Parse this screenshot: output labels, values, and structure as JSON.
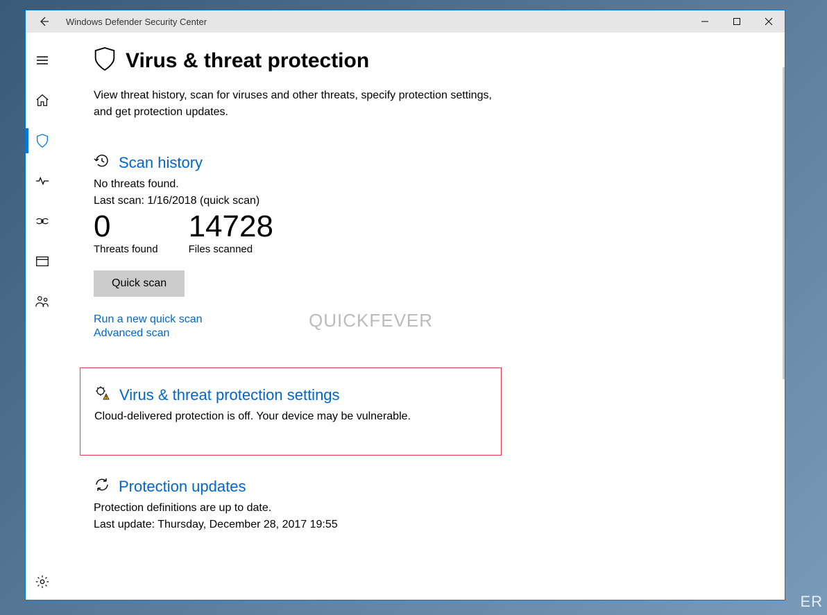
{
  "window": {
    "title": "Windows Defender Security Center"
  },
  "page": {
    "title": "Virus & threat protection",
    "description": "View threat history, scan for viruses and other threats, specify protection settings, and get protection updates."
  },
  "scan_history": {
    "heading": "Scan history",
    "no_threats": "No threats found.",
    "last_scan": "Last scan: 1/16/2018 (quick scan)",
    "threats_found_value": "0",
    "threats_found_label": "Threats found",
    "files_scanned_value": "14728",
    "files_scanned_label": "Files scanned",
    "quick_scan_btn": "Quick scan",
    "run_new_link": "Run a new quick scan",
    "advanced_link": "Advanced scan"
  },
  "settings_section": {
    "heading": "Virus & threat protection settings",
    "warning": "Cloud-delivered protection is off. Your device may be vulnerable."
  },
  "updates_section": {
    "heading": "Protection updates",
    "status": "Protection definitions are up to date.",
    "last_update": "Last update: Thursday, December 28, 2017 19:55"
  },
  "watermark": {
    "light": "QUICK",
    "bold": "FEVER"
  },
  "bg_text": "ER"
}
